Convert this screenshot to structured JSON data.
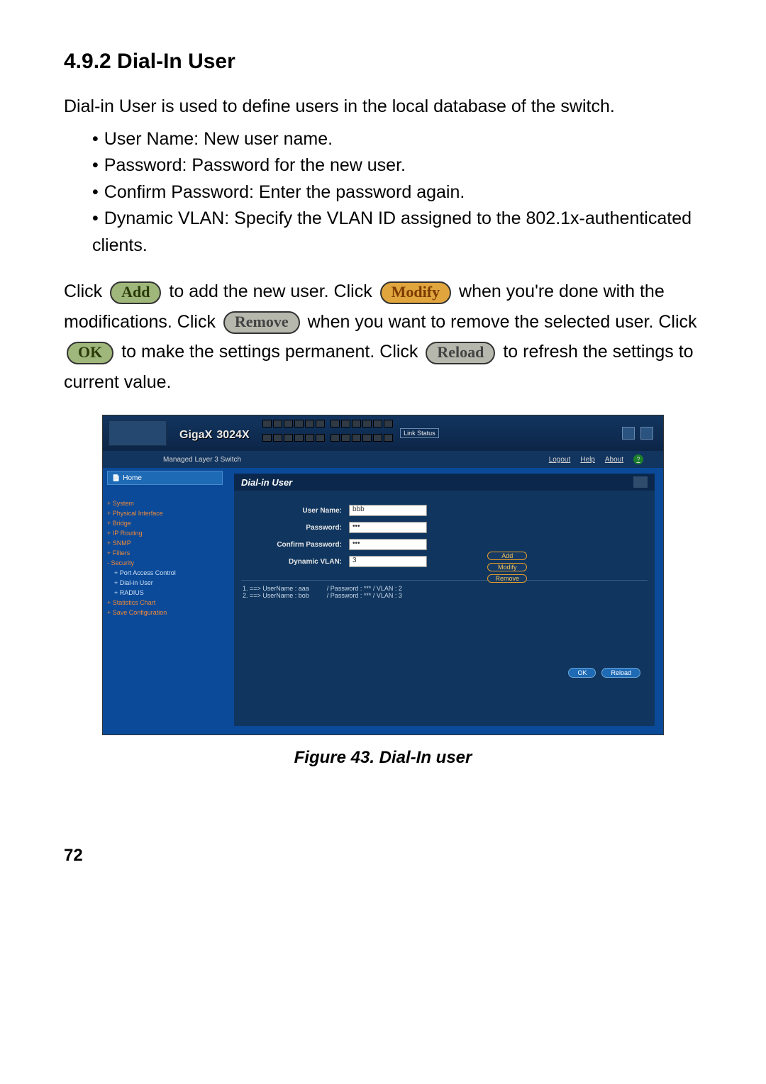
{
  "heading": "4.9.2    Dial-In User",
  "intro": "Dial-in User is used to define users in the local database of the switch.",
  "bullets": [
    "User Name: New user name.",
    "Password: Password for the new user.",
    "Confirm Password: Enter the password again.",
    "Dynamic VLAN: Specify the VLAN ID assigned to the 802.1x-authenticated clients."
  ],
  "flow": {
    "click1": "Click ",
    "btn_add": "Add",
    "after_add": " to add the new user. Click ",
    "btn_modify": "Modify",
    "after_modify": " when you're done with the modifications. Click ",
    "btn_remove": "Remove",
    "after_remove": " when you want to remove the selected user. Click ",
    "btn_ok": "OK",
    "after_ok": " to make the settings permanent. Click ",
    "btn_reload": "Reload",
    "after_reload": " to refresh the settings to current value."
  },
  "figure_caption": "Figure 43.   Dial-In user",
  "page_number": "72",
  "shot": {
    "brand": "GigaX",
    "brand_model": "3024X",
    "link_status_label": "Link Status",
    "model_line": "Managed Layer 3 Switch",
    "right_links": [
      "Logout",
      "Help",
      "About"
    ],
    "home": "Home",
    "nav": [
      {
        "cls": "l1",
        "t": "+ System"
      },
      {
        "cls": "l1",
        "t": "+ Physical Interface"
      },
      {
        "cls": "l1",
        "t": "+ Bridge"
      },
      {
        "cls": "l1",
        "t": "+ IP Routing"
      },
      {
        "cls": "l1",
        "t": "+ SNMP"
      },
      {
        "cls": "l1",
        "t": "+ Filters"
      },
      {
        "cls": "l1",
        "t": "- Security"
      },
      {
        "cls": "l2b",
        "t": "+ Port Access Control"
      },
      {
        "cls": "l2b",
        "t": "+ Dial-in User"
      },
      {
        "cls": "l2b",
        "t": "+ RADIUS"
      },
      {
        "cls": "l1",
        "t": "+ Statistics Chart"
      },
      {
        "cls": "l1",
        "t": "+ Save Configuration"
      }
    ],
    "panel_title": "Dial-in User",
    "form": {
      "user_label": "User Name:",
      "user_value": "bbb",
      "pw_label": "Password:",
      "pw_value": "•••",
      "cpw_label": "Confirm Password:",
      "cpw_value": "•••",
      "vlan_label": "Dynamic VLAN:",
      "vlan_value": "3"
    },
    "action_buttons": [
      "Add",
      "Modify",
      "Remove"
    ],
    "user_rows": [
      "1. ==> UserName : aaa          / Password : *** / VLAN : 2",
      "2. ==> UserName : bob          / Password : *** / VLAN : 3"
    ],
    "ok_label": "OK",
    "reload_label": "Reload"
  }
}
